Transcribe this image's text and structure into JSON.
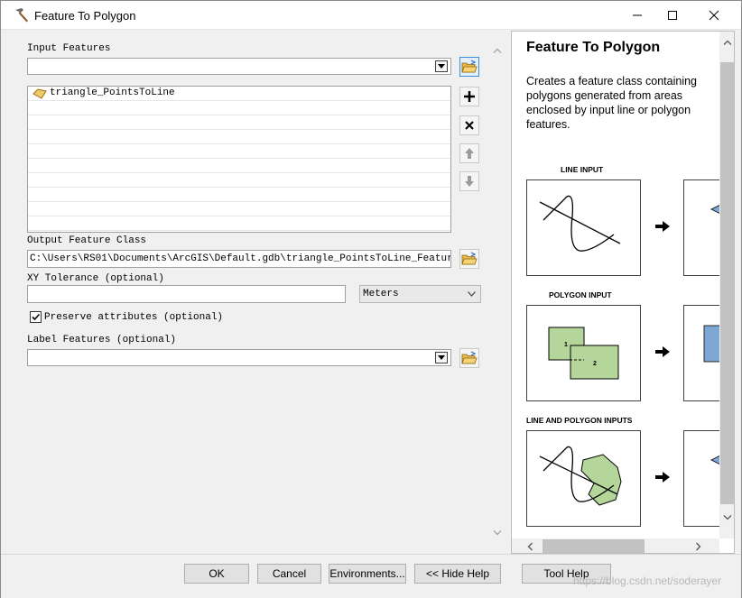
{
  "window": {
    "title": "Feature To Polygon"
  },
  "form": {
    "input_features": {
      "label": "Input Features",
      "value": "",
      "items": [
        "triangle_PointsToLine"
      ]
    },
    "output_feature_class": {
      "label": "Output Feature Class",
      "value": "C:\\Users\\RS01\\Documents\\ArcGIS\\Default.gdb\\triangle_PointsToLine_Featur"
    },
    "xy_tolerance": {
      "label": "XY Tolerance (optional)",
      "value": "",
      "unit": "Meters"
    },
    "preserve_attributes": {
      "label": "Preserve attributes (optional)",
      "checked": true
    },
    "label_features": {
      "label": "Label Features (optional)",
      "value": ""
    }
  },
  "help": {
    "title": "Feature To Polygon",
    "description": "Creates a feature class containing polygons generated from areas enclosed by input line or polygon features.",
    "sections": [
      {
        "label": "LINE INPUT"
      },
      {
        "label": "POLYGON INPUT",
        "polygon_labels": [
          "1",
          "2"
        ]
      },
      {
        "label": "LINE AND POLYGON INPUTS"
      }
    ],
    "colors": {
      "polygon_fill": "#b5d69b",
      "output_fill": "#7fa7d6"
    }
  },
  "buttons": {
    "ok": "OK",
    "cancel": "Cancel",
    "environments": "Environments...",
    "hide_help": "<< Hide Help",
    "tool_help": "Tool Help"
  },
  "watermark": "https://blog.csdn.net/soderayer"
}
